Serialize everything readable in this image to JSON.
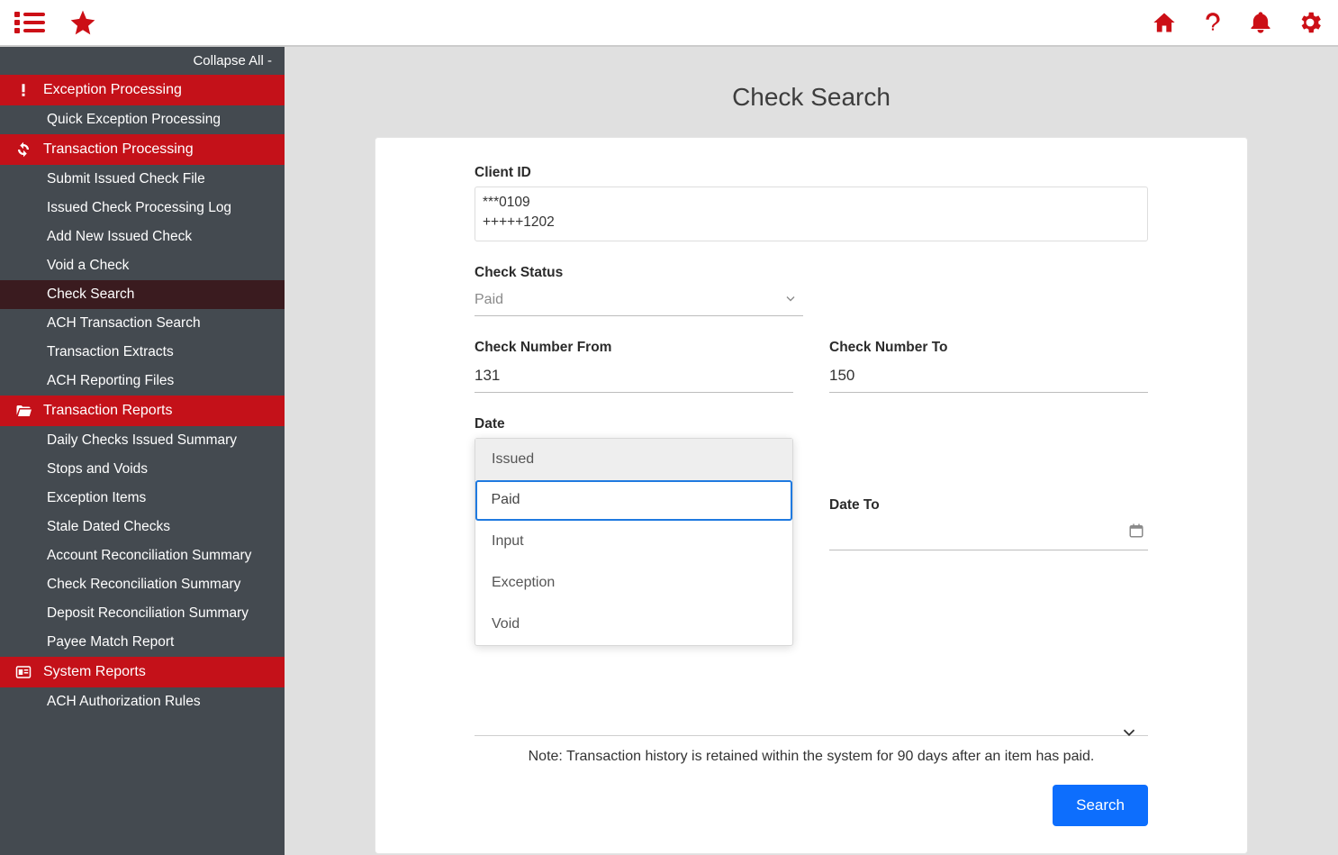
{
  "topbar": {
    "icons_left": [
      "menu",
      "star"
    ],
    "icons_right": [
      "home",
      "help",
      "bell",
      "gear"
    ]
  },
  "sidebar": {
    "collapse_label": "Collapse All -",
    "sections": [
      {
        "title": "Exception Processing",
        "icon": "alert",
        "items": [
          "Quick Exception Processing"
        ]
      },
      {
        "title": "Transaction Processing",
        "icon": "refresh",
        "items": [
          "Submit Issued Check File",
          "Issued Check Processing Log",
          "Add New Issued Check",
          "Void a Check",
          "Check Search",
          "ACH Transaction Search",
          "Transaction Extracts",
          "ACH Reporting Files"
        ],
        "active_item": "Check Search"
      },
      {
        "title": "Transaction Reports",
        "icon": "folder",
        "items": [
          "Daily Checks Issued Summary",
          "Stops and Voids",
          "Exception Items",
          "Stale Dated Checks",
          "Account Reconciliation Summary",
          "Check Reconciliation Summary",
          "Deposit Reconciliation Summary",
          "Payee Match Report"
        ]
      },
      {
        "title": "System Reports",
        "icon": "report",
        "items": [
          "ACH Authorization Rules"
        ]
      }
    ]
  },
  "page": {
    "title": "Check Search",
    "client_id_label": "Client ID",
    "client_ids": [
      "***0109",
      "+++++1202"
    ],
    "check_status_label": "Check Status",
    "check_status_value": "Paid",
    "check_number_from_label": "Check Number From",
    "check_number_from_value": "131",
    "check_number_to_label": "Check Number To",
    "check_number_to_value": "150",
    "date_label": "Date",
    "date_type_options": [
      "Issued",
      "Paid",
      "Input",
      "Exception",
      "Void"
    ],
    "date_type_selected": "Paid",
    "date_to_label": "Date To",
    "date_to_value": "",
    "note": "Note: Transaction history is retained within the system for 90 days after an item has paid.",
    "search_button": "Search"
  }
}
